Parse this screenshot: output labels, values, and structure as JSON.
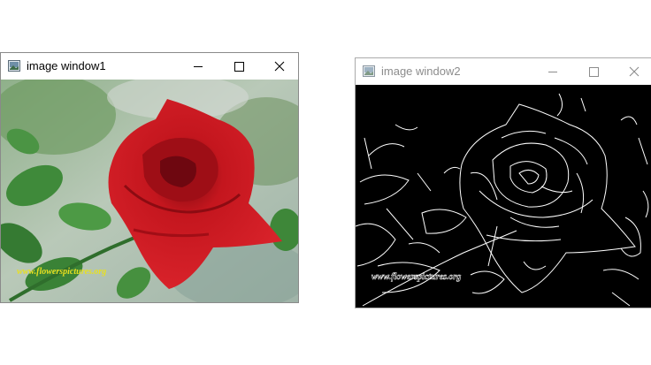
{
  "window1": {
    "title": "image window1",
    "app_icon": "image-window-icon",
    "watermark": "www.flowerspictures.org",
    "controls": [
      "minimize-icon",
      "maximize-icon",
      "close-icon"
    ]
  },
  "window2": {
    "title": "image window2",
    "app_icon": "image-window-icon",
    "watermark_edges": "www.flowerspictures.org",
    "controls": [
      "minimize-icon",
      "maximize-icon",
      "close-icon"
    ]
  },
  "colors": {
    "rose_red": "#c8141c",
    "leaf_green": "#3f8a3a",
    "edge_background": "#000000",
    "edge_lines": "#ffffff"
  }
}
